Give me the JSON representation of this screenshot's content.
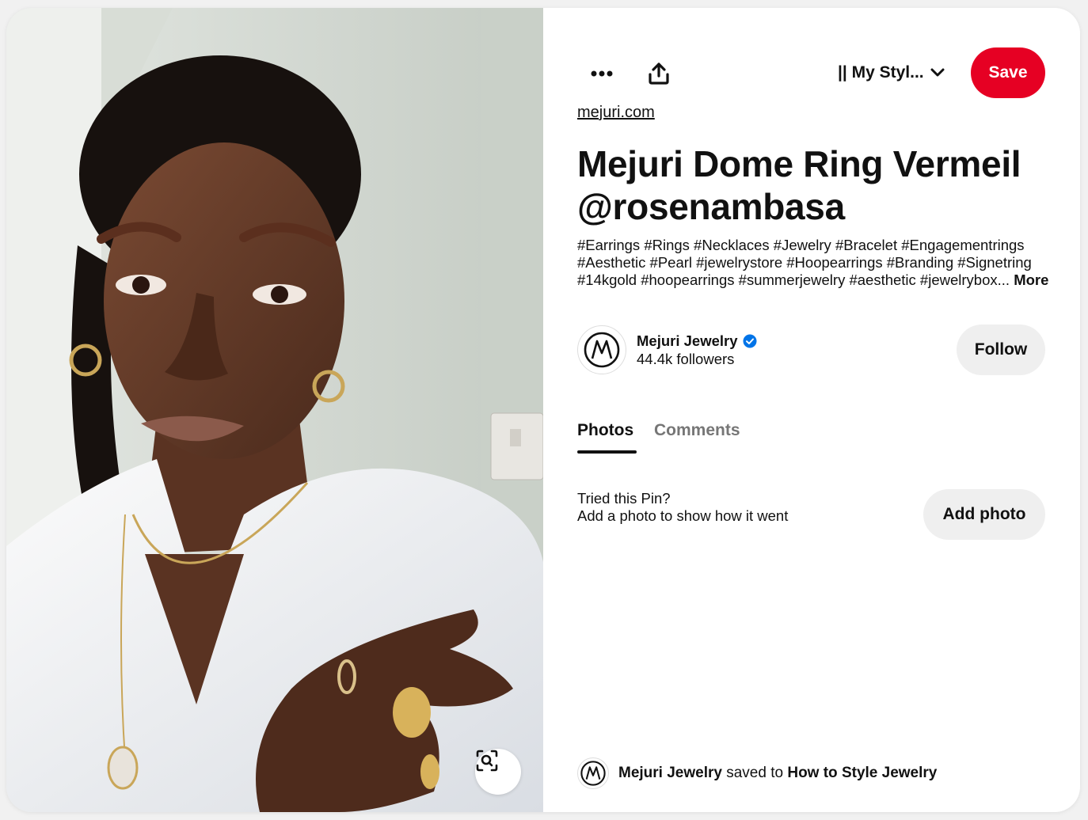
{
  "colors": {
    "accent": "#e60023",
    "secondary_button": "#efefef",
    "verified": "#0074e8",
    "muted_text": "#767676"
  },
  "toolbar": {
    "more_icon": "more-horizontal-icon",
    "share_icon": "share-upload-icon",
    "board_name": "|| My Styl...",
    "board_chevron_icon": "chevron-down-icon",
    "save_label": "Save"
  },
  "pin": {
    "source": "mejuri.com",
    "title": "Mejuri Dome Ring Vermeil @rosenambasa",
    "description": "#Earrings #Rings #Necklaces #Jewelry #Bracelet #Engagementrings #Aesthetic #Pearl #jewelrystore #Hoopearrings #Branding #Signetring #14kgold #hoopearrings #summerjewelry #aesthetic #jewelrybox...",
    "more_label": "More",
    "visual_search_icon": "visual-search-icon"
  },
  "creator": {
    "name": "Mejuri Jewelry",
    "verified_icon": "verified-badge-icon",
    "followers": "44.4k followers",
    "follow_label": "Follow"
  },
  "tabs": [
    {
      "label": "Photos",
      "active": true
    },
    {
      "label": "Comments",
      "active": false
    }
  ],
  "tried": {
    "title": "Tried this Pin?",
    "subtitle": "Add a photo to show how it went",
    "button_label": "Add photo"
  },
  "saved_by": {
    "user": "Mejuri Jewelry",
    "middle": "saved to",
    "board": "How to Style Jewelry"
  }
}
